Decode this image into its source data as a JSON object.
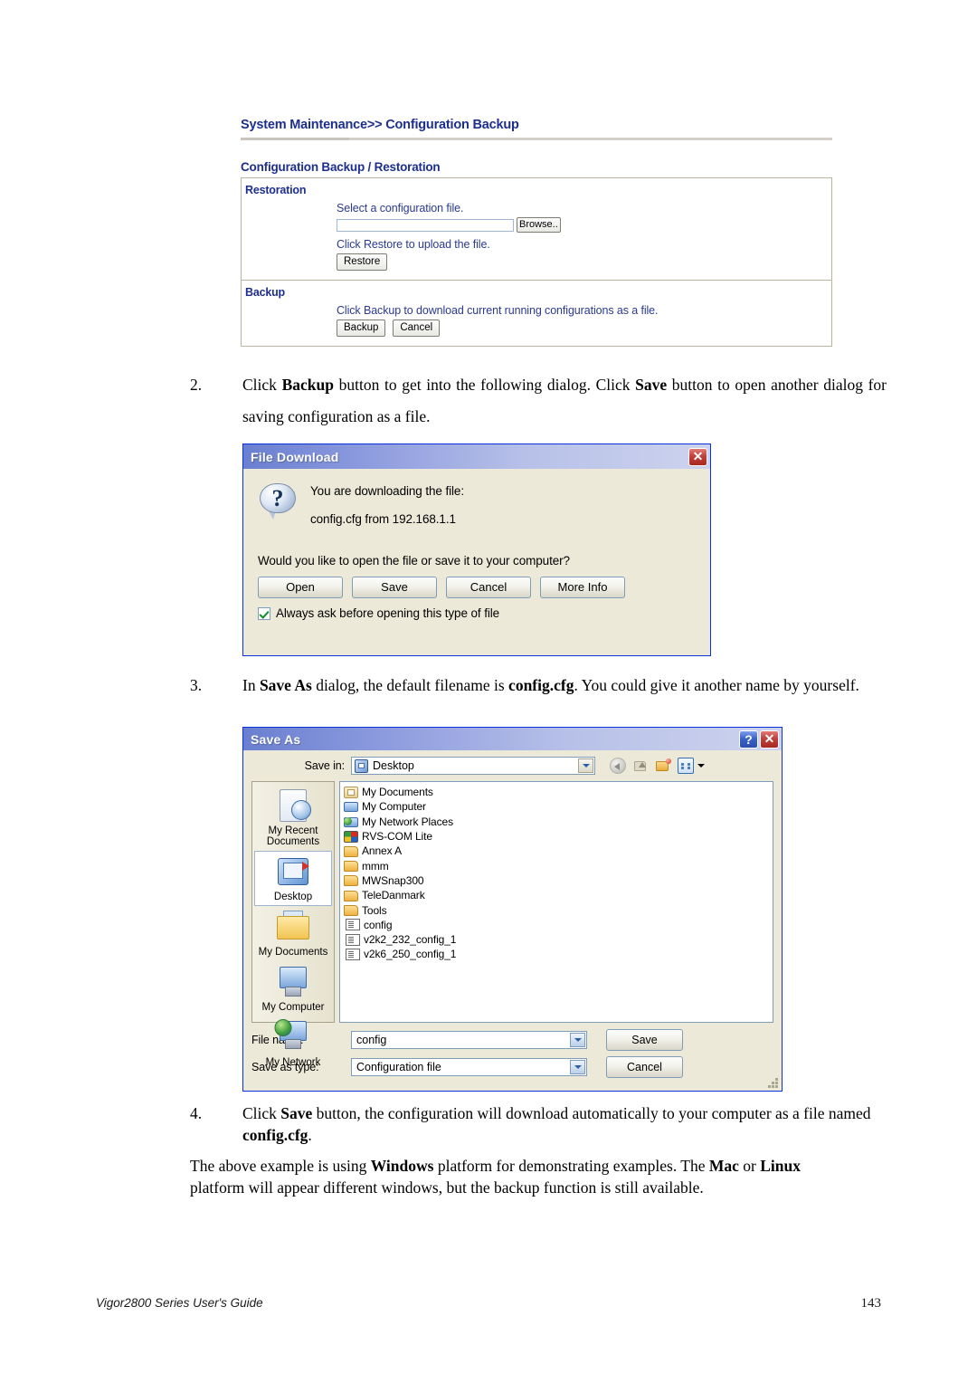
{
  "router_ui": {
    "breadcrumb_left": "System Maintenance",
    "breadcrumb_sep": ">>",
    "breadcrumb_right": "Configuration Backup",
    "section_title": "Configuration Backup / Restoration",
    "restoration": {
      "label": "Restoration",
      "select_text": "Select a configuration file.",
      "input_value": "",
      "browse_label": "Browse..",
      "click_restore_text": "Click Restore to upload the file.",
      "restore_label": "Restore"
    },
    "backup": {
      "label": "Backup",
      "click_backup_text": "Click Backup to download current running configurations as a file.",
      "backup_label": "Backup",
      "cancel_label": "Cancel"
    }
  },
  "steps": {
    "step2": {
      "number": "2.",
      "html": "Click <b>Backup</b> button to get into the following dialog. Click <b>Save</b> button to open another dialog for saving configuration as a file."
    },
    "step3": {
      "number": "3.",
      "html": "In <b>Save As</b> dialog, the default filename is <b>config.cfg</b>. You could give it another name by yourself."
    },
    "step4": {
      "number": "4.",
      "html": "Click <b>Save</b> button, the configuration will download automatically to your computer as a file named <b>config.cfg</b>."
    },
    "note": {
      "html": "The above example is using <b>Windows</b> platform for demonstrating examples. The <b>Mac</b> or <b>Linux</b> platform will appear different windows, but the backup function is still available."
    }
  },
  "file_download_dialog": {
    "title": "File Download",
    "close_glyph": "✕",
    "line1": "You are downloading the file:",
    "line2": "config.cfg from 192.168.1.1",
    "question": "Would you like to open the file or save it to your computer?",
    "buttons": [
      "Open",
      "Save",
      "Cancel",
      "More Info"
    ],
    "checkbox_label": "Always ask before opening this type of file",
    "checkbox_checked": true
  },
  "save_as_dialog": {
    "title": "Save As",
    "help_glyph": "?",
    "close_glyph": "✕",
    "save_in_label": "Save in:",
    "save_in_value": "Desktop",
    "toolbar_icons": [
      "back-icon",
      "up-one-level-icon",
      "new-folder-icon",
      "views-icon"
    ],
    "places": [
      {
        "label": "My Recent\nDocuments",
        "name": "my-recent-documents",
        "selected": false
      },
      {
        "label": "Desktop",
        "name": "desktop",
        "selected": true
      },
      {
        "label": "My Documents",
        "name": "my-documents",
        "selected": false
      },
      {
        "label": "My Computer",
        "name": "my-computer",
        "selected": false
      },
      {
        "label": "My Network",
        "name": "my-network",
        "selected": false
      }
    ],
    "files": [
      {
        "label": "My Documents",
        "kind": "mydocs"
      },
      {
        "label": "My Computer",
        "kind": "mycomp"
      },
      {
        "label": "My Network Places",
        "kind": "mynet"
      },
      {
        "label": "RVS-COM Lite",
        "kind": "rvs"
      },
      {
        "label": "Annex A",
        "kind": "folder"
      },
      {
        "label": "mmm",
        "kind": "folder"
      },
      {
        "label": "MWSnap300",
        "kind": "folder"
      },
      {
        "label": "TeleDanmark",
        "kind": "folder"
      },
      {
        "label": "Tools",
        "kind": "folder"
      },
      {
        "label": "config",
        "kind": "doc"
      },
      {
        "label": "v2k2_232_config_1",
        "kind": "doc"
      },
      {
        "label": "v2k6_250_config_1",
        "kind": "doc"
      }
    ],
    "file_name_label": "File name:",
    "file_name_value": "config",
    "save_as_type_label": "Save as type:",
    "save_as_type_value": "Configuration file",
    "save_button": "Save",
    "cancel_button": "Cancel"
  },
  "footer": {
    "left": "Vigor2800 Series User's Guide",
    "page_number": "143"
  },
  "colors": {
    "router_blue": "#1d2f8e",
    "router_text_blue": "#2b3a8f",
    "dialog_face": "#ece9d8",
    "titlebar_blue": "#6a7fd0",
    "close_red": "#c2403a",
    "check_green": "#0a8f2a"
  }
}
